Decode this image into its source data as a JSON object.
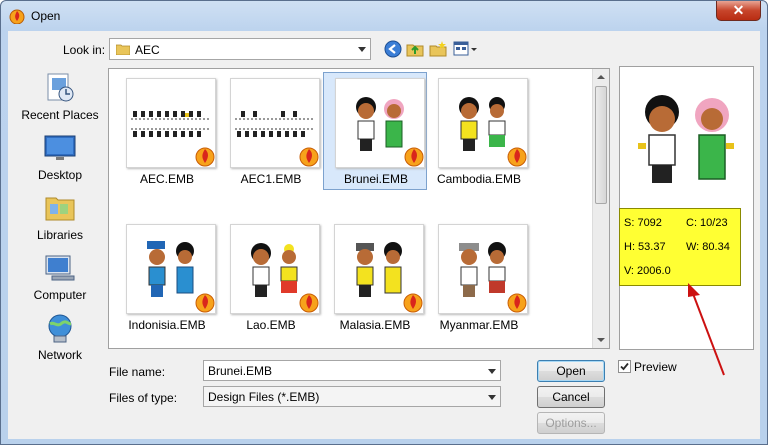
{
  "window": {
    "title": "Open",
    "close_label": "✕"
  },
  "toolbar": {
    "look_in_label": "Look in:",
    "look_in_value": "AEC"
  },
  "places": [
    {
      "label": "Recent Places",
      "icon": "recent-places-icon"
    },
    {
      "label": "Desktop",
      "icon": "desktop-icon"
    },
    {
      "label": "Libraries",
      "icon": "libraries-icon"
    },
    {
      "label": "Computer",
      "icon": "computer-icon"
    },
    {
      "label": "Network",
      "icon": "network-icon"
    }
  ],
  "files": [
    {
      "name": "AEC.EMB",
      "selected": false
    },
    {
      "name": "AEC1.EMB",
      "selected": false
    },
    {
      "name": "Brunei.EMB",
      "selected": true
    },
    {
      "name": "Cambodia.EMB",
      "selected": false
    },
    {
      "name": "Indonisia.EMB",
      "selected": false
    },
    {
      "name": "Lao.EMB",
      "selected": false
    },
    {
      "name": "Malasia.EMB",
      "selected": false
    },
    {
      "name": "Myanmar.EMB",
      "selected": false
    }
  ],
  "preview_info": {
    "s": "S: 7092",
    "c": "C: 10/23",
    "h": "H: 53.37",
    "w": "W: 80.34",
    "v": "V: 2006.0"
  },
  "form": {
    "file_name_label": "File name:",
    "file_name_value": "Brunei.EMB",
    "file_type_label": "Files of type:",
    "file_type_value": "Design Files (*.EMB)"
  },
  "buttons": {
    "open": "Open",
    "cancel": "Cancel",
    "options": "Options..."
  },
  "preview_checkbox": {
    "label": "Preview",
    "checked": true
  },
  "colors": {
    "accent_yellow": "#ffff33",
    "arrow_red": "#cc1111",
    "selection": "#d8e8fb"
  }
}
